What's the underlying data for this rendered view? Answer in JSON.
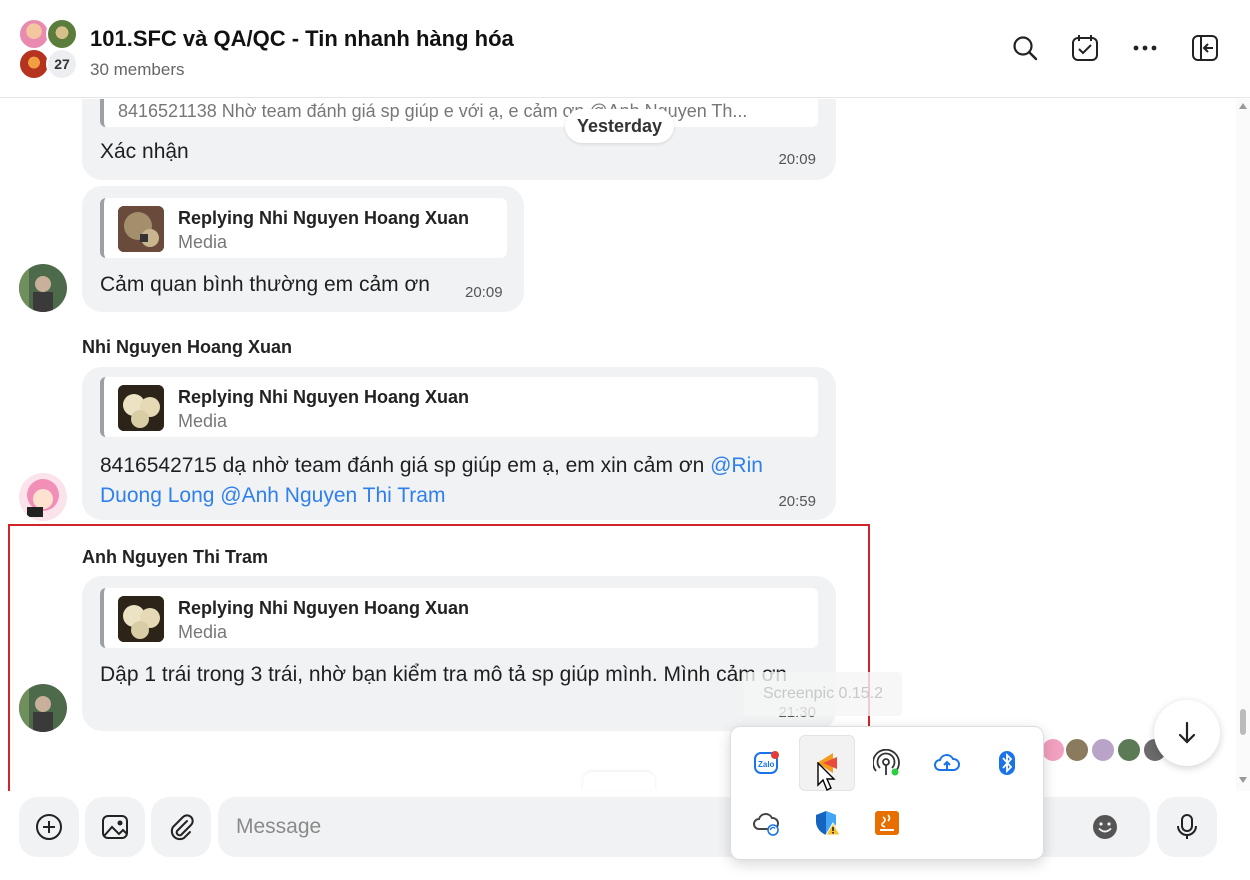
{
  "header": {
    "title": "101.SFC và QA/QC - Tin nhanh hàng hóa",
    "members": "30 members",
    "avatar_count": "27",
    "icons": [
      "search-icon",
      "task-icon",
      "more-icon",
      "panel-toggle-icon"
    ]
  },
  "chat": {
    "date_separator": "Yesterday",
    "messages": [
      {
        "quote_text": "8416521138 Nhờ team đánh giá sp giúp e với ạ, e cảm ơn @Anh Nguyen Th...",
        "text": "Xác nhận",
        "time": "20:09"
      },
      {
        "quote_title": "Replying Nhi Nguyen Hoang Xuan",
        "quote_sub": "Media",
        "text": "Cảm quan bình thường em cảm ơn",
        "time": "20:09"
      },
      {
        "sender": "Nhi Nguyen Hoang Xuan",
        "quote_title": "Replying Nhi Nguyen Hoang Xuan",
        "quote_sub": "Media",
        "text": "8416542715 dạ nhờ team đánh giá sp giúp em ạ, em xin cảm ơn",
        "mention1": "@Rin Duong Long",
        "mention2": "@Anh Nguyen Thi Tram",
        "time": "20:59"
      },
      {
        "sender": "Anh Nguyen Thi Tram",
        "quote_title": "Replying Nhi Nguyen Hoang Xuan",
        "quote_sub": "Media",
        "text": "Dập 1 trái trong 3 trái, nhờ bạn kiểm tra mô tả sp giúp mình. Mình cảm ơn",
        "time": "21:30"
      }
    ]
  },
  "tray": {
    "tooltip": "Screenpic 0.15.2",
    "icons": [
      "zalo-icon",
      "screenpic-icon",
      "hotspot-icon",
      "cloud-icon",
      "bluetooth-icon",
      "onedrive-sync-icon",
      "security-warning-icon",
      "java-icon"
    ]
  },
  "composer": {
    "placeholder": "Message",
    "icons": [
      "add-icon",
      "image-icon",
      "attach-icon",
      "emoji-icon",
      "microphone-icon"
    ]
  },
  "colors": {
    "accent": "#2f80ed",
    "bubble": "#f1f2f4",
    "selection": "#d0232a"
  }
}
